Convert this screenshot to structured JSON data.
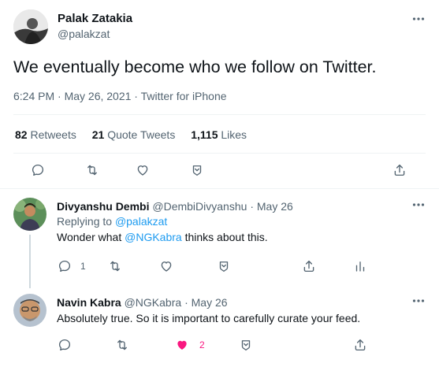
{
  "main_tweet": {
    "author_name": "Palak Zatakia",
    "author_handle": "@palakzat",
    "text": "We eventually become who we follow on Twitter.",
    "timestamp": "6:24 PM · May 26, 2021 · Twitter for iPhone",
    "stats": {
      "retweets_count": "82",
      "retweets_label": "Retweets",
      "quote_count": "21",
      "quote_label": "Quote Tweets",
      "likes_count": "1,115",
      "likes_label": "Likes"
    },
    "icons": [
      "reply-icon",
      "retweet-icon",
      "like-icon",
      "save-icon",
      "share-icon"
    ]
  },
  "reply_1": {
    "author_name": "Divyanshu Dembi",
    "author_handle": "@DembiDivyanshu",
    "date": "· May 26",
    "replying_to_label": "Replying to",
    "replying_to_handle": "@palakzat",
    "text_before": "Wonder what ",
    "mention": "@NGKabra",
    "text_after": " thinks about this.",
    "reply_count": "1",
    "icons": [
      "reply-icon",
      "retweet-icon",
      "like-icon",
      "save-icon",
      "share-icon",
      "analytics-icon"
    ]
  },
  "reply_2": {
    "author_name": "Navin Kabra",
    "author_handle": "@NGKabra",
    "date": "· May 26",
    "text": "Absolutely true. So it is important to carefully curate your feed.",
    "like_count": "2",
    "liked": true,
    "icons": [
      "reply-icon",
      "retweet-icon",
      "like-icon",
      "save-icon",
      "share-icon"
    ]
  },
  "colors": {
    "accent": "#1d9bf0",
    "like_active": "#f91880",
    "muted": "#536471"
  }
}
